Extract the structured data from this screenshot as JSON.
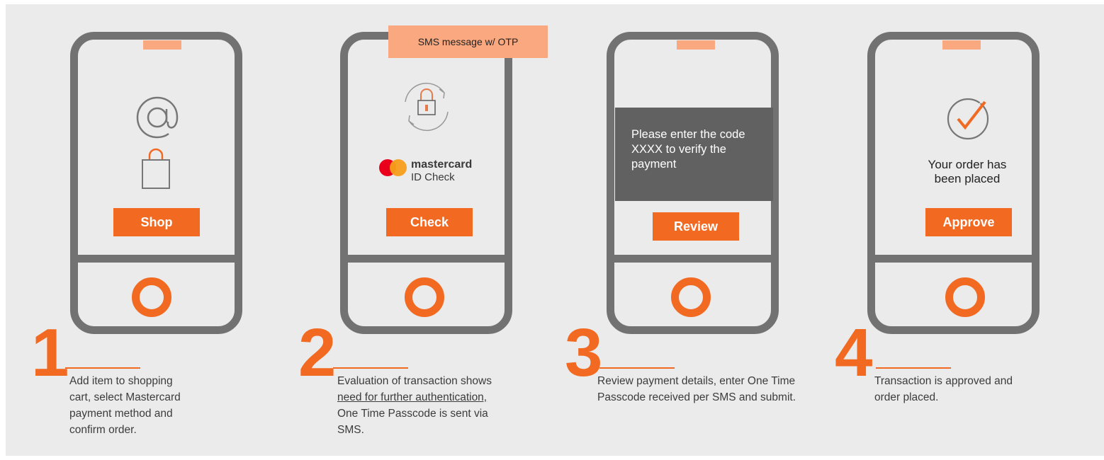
{
  "colors": {
    "accent": "#f26a22",
    "speaker_accent": "#f9a87f",
    "phone_frame": "#727272",
    "background": "#ebebeb",
    "message_box": "#616161"
  },
  "steps": [
    {
      "number": "1",
      "button_label": "Shop",
      "icons": [
        "at-sign-icon",
        "shopping-bag-icon"
      ],
      "description": "Add item to shopping cart, select Mastercard payment method and confirm order."
    },
    {
      "number": "2",
      "button_label": "Check",
      "sms_banner": "SMS message w/ OTP",
      "icons": [
        "refresh-lock-icon",
        "mastercard-logo-icon"
      ],
      "brand_name": "mastercard",
      "brand_product": "ID Check",
      "description_pre": "Evaluation of  transaction shows ",
      "description_underlined": "need for further authentication, ",
      "description_post": "One Time Passcode is sent via SMS."
    },
    {
      "number": "3",
      "button_label": "Review",
      "message": "Please enter the code XXXX to verify the payment",
      "description": "Review payment details, enter One Time Passcode received per SMS and submit."
    },
    {
      "number": "4",
      "button_label": "Approve",
      "icons": [
        "check-circle-icon"
      ],
      "order_message": "Your order has been placed",
      "description": "Transaction is approved and order placed."
    }
  ]
}
